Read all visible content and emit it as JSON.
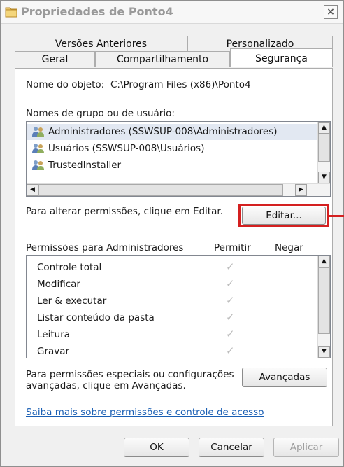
{
  "window": {
    "title": "Propriedades de Ponto4",
    "close_glyph": "×"
  },
  "tabs": {
    "row1": [
      "Versões Anteriores",
      "Personalizado"
    ],
    "row2": [
      "Geral",
      "Compartilhamento",
      "Segurança"
    ],
    "active": "Segurança"
  },
  "object": {
    "label": "Nome do objeto:",
    "value": "C:\\Program Files (x86)\\Ponto4"
  },
  "groups": {
    "label": "Nomes de grupo ou de usuário:",
    "items": [
      {
        "name": "Administradores (SSWSUP-008\\Administradores)",
        "icon": "users-icon",
        "selected": true
      },
      {
        "name": "Usuários (SSWSUP-008\\Usuários)",
        "icon": "users-icon",
        "selected": false
      },
      {
        "name": "TrustedInstaller",
        "icon": "users-icon",
        "selected": false
      }
    ]
  },
  "edit": {
    "hint": "Para alterar permissões, clique em Editar.",
    "button": "Editar...",
    "highlight_color": "#d42020"
  },
  "permissions": {
    "title": "Permissões para Administradores",
    "allow_header": "Permitir",
    "deny_header": "Negar",
    "rows": [
      {
        "name": "Controle total",
        "allow": true,
        "deny": false
      },
      {
        "name": "Modificar",
        "allow": true,
        "deny": false
      },
      {
        "name": "Ler & executar",
        "allow": true,
        "deny": false
      },
      {
        "name": "Listar conteúdo da pasta",
        "allow": true,
        "deny": false
      },
      {
        "name": "Leitura",
        "allow": true,
        "deny": false
      },
      {
        "name": "Gravar",
        "allow": true,
        "deny": false
      }
    ],
    "check_glyph": "✓"
  },
  "advanced": {
    "hint_line1": "Para permissões especiais ou configurações",
    "hint_line2": "avançadas, clique em Avançadas.",
    "button": "Avançadas"
  },
  "help_link": "Saiba mais sobre permissões e controle de acesso",
  "footer": {
    "ok": "OK",
    "cancel": "Cancelar",
    "apply": "Aplicar",
    "apply_enabled": false
  }
}
